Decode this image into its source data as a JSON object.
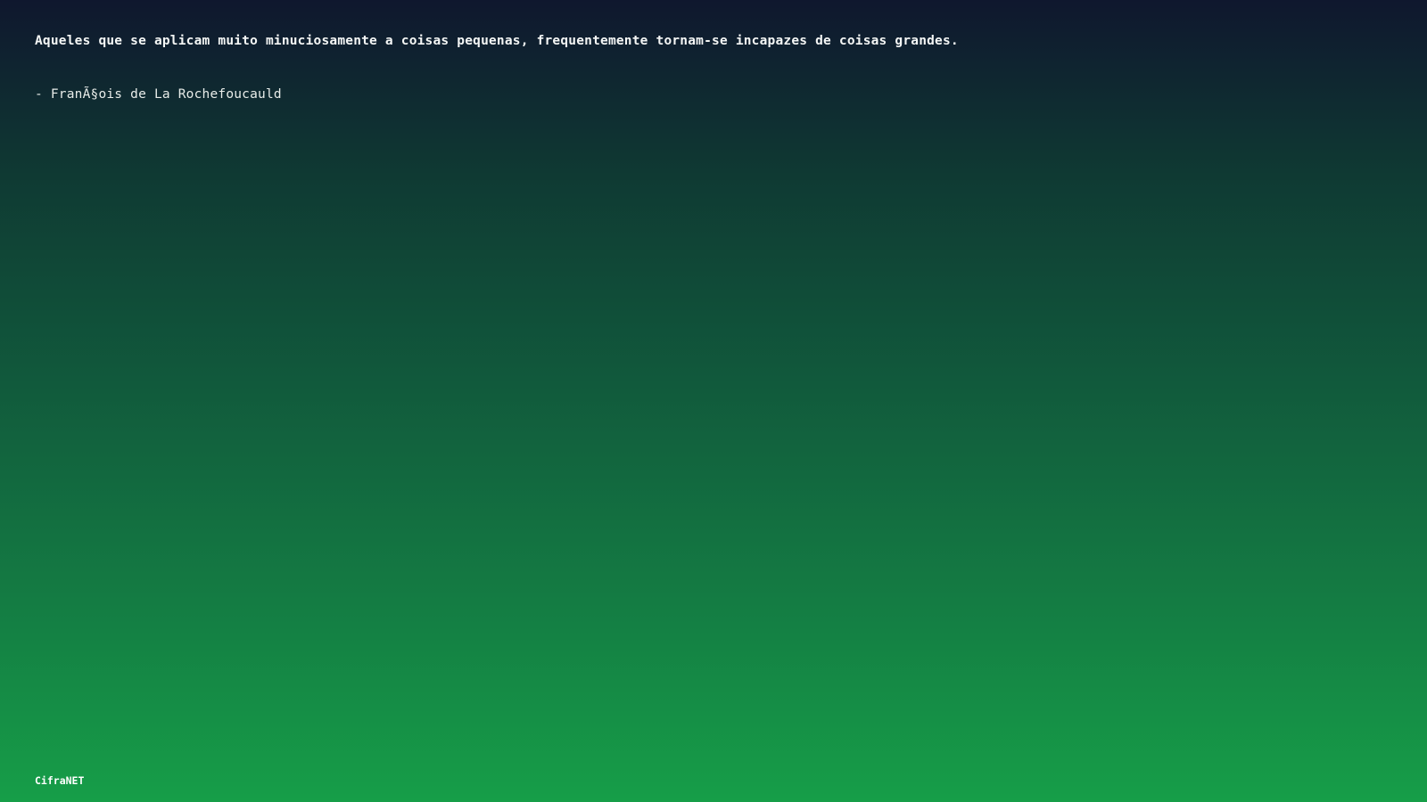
{
  "quote": {
    "text": "Aqueles que se aplicam muito minuciosamente a coisas pequenas, frequentemente tornam-se incapazes de coisas grandes.",
    "author": "- FranÃ§ois de La Rochefoucauld"
  },
  "footer": {
    "brand": "CifraNET"
  },
  "colors": {
    "background_top": "#0f172e",
    "background_bottom": "#169e48",
    "text": "#ffffff"
  }
}
